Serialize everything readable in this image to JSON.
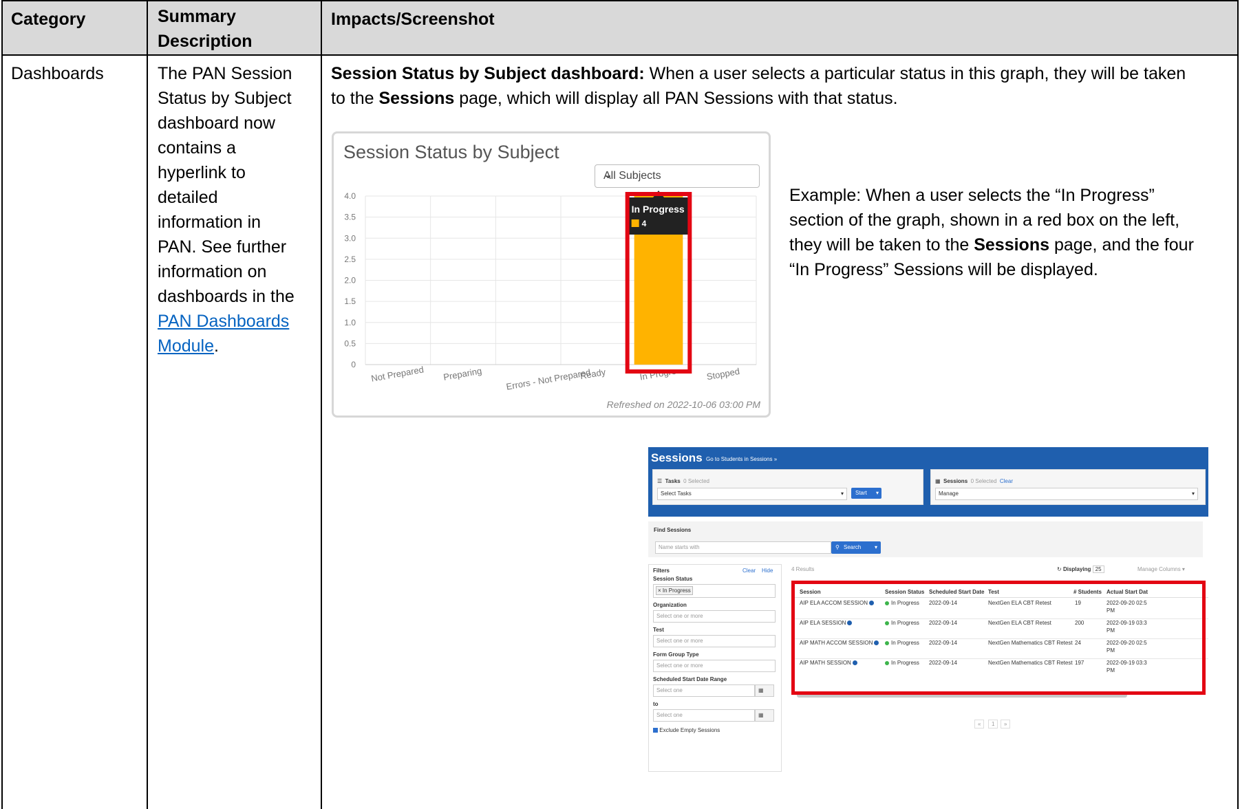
{
  "table": {
    "headers": {
      "category": "Category",
      "summary_line1": "Summary",
      "summary_line2": "Description",
      "impacts": "Impacts/Screenshot"
    },
    "row": {
      "category": "Dashboards",
      "summary_lines": [
        "The PAN Session",
        "Status by Subject",
        "dashboard now",
        "contains a",
        "hyperlink to",
        "detailed",
        "information in",
        "PAN. See further",
        "information on",
        "dashboards in the"
      ],
      "summary_link_line1": "PAN Dashboards",
      "summary_link_line2": "Module",
      "summary_period": ".",
      "impact_bold": "Session Status by Subject dashboard:",
      "impact_rest1": " When a user selects a particular status in this graph, they will be taken",
      "impact_line2_pre": "to the ",
      "impact_line2_bold": "Sessions",
      "impact_line2_post": " page, which will display all PAN Sessions with that status."
    }
  },
  "example": {
    "line1": "Example: When a user selects the “In Progress”",
    "line2": "section of the graph, shown in a red box on the left,",
    "line3_pre": "they will be taken to the ",
    "line3_bold": "Sessions",
    "line3_post": " page, and the four",
    "line4": "“In Progress” Sessions will be displayed."
  },
  "chart_data": {
    "type": "bar",
    "title": "Session Status by Subject",
    "filter_value": "All Subjects",
    "categories": [
      "Not Prepared",
      "Preparing",
      "Errors - Not Prepared",
      "Ready",
      "In Progress",
      "Stopped"
    ],
    "values": [
      0,
      0,
      0,
      0,
      4,
      0
    ],
    "ylim": [
      0,
      4.0
    ],
    "yticks": [
      "0",
      "0.5",
      "1.0",
      "1.5",
      "2.0",
      "2.5",
      "3.0",
      "3.5",
      "4.0"
    ],
    "tick_labels_visible": [
      "Not Prepared",
      "Preparing",
      "Errors - Not Prepared",
      "Ready",
      "In Progre",
      "Stopped"
    ],
    "tooltip": {
      "title": "In Progress",
      "value": "4"
    },
    "bar_color": "#ffb300",
    "highlight_color": "#e30613",
    "grid": true,
    "refreshed": "Refreshed on 2022-10-06 03:00 PM"
  },
  "sessions_screen": {
    "title": "Sessions",
    "goto_link": "Go to Students in Sessions »",
    "tasks_label": "Tasks",
    "tasks_selected": "0 Selected",
    "tasks_select": "Select Tasks",
    "start_button": "Start",
    "sessions_label": "Sessions",
    "sessions_selected": "0 Selected",
    "sessions_clear": "Clear",
    "manage_select": "Manage",
    "find_sessions": "Find Sessions",
    "search_placeholder": "Name starts with",
    "search_button": "Search",
    "filters_label": "Filters",
    "filters_clear": "Clear",
    "filters_hide": "Hide",
    "filter_session_status": "Session Status",
    "filter_status_tag": "× In Progress",
    "filter_organization": "Organization",
    "filter_organization_ph": "Select one or more",
    "filter_test": "Test",
    "filter_test_ph": "Select one or more",
    "filter_form_group": "Form Group Type",
    "filter_form_group_ph": "Select one or more",
    "filter_sched_range": "Scheduled Start Date Range",
    "filter_sched_from_ph": "Select one",
    "filter_to": "to",
    "filter_sched_to_ph": "Select one",
    "exclude_empty": "Exclude Empty Sessions",
    "results_count": "4 Results",
    "displaying_label": "Displaying",
    "displaying_value": "25",
    "manage_columns": "Manage Columns ▾",
    "columns": [
      "Session",
      "Session Status",
      "Scheduled Start Date",
      "Test",
      "# Students",
      "Actual Start Dat"
    ],
    "rows": [
      {
        "session": "AIP ELA ACCOM SESSION",
        "status": "In Progress",
        "sched": "2022-09-14",
        "test": "NextGen ELA CBT Retest",
        "students": "19",
        "actual1": "2022-09-20 02:5",
        "actual2": "PM"
      },
      {
        "session": "AIP ELA SESSION",
        "status": "In Progress",
        "sched": "2022-09-14",
        "test": "NextGen ELA CBT Retest",
        "students": "200",
        "actual1": "2022-09-19 03:3",
        "actual2": "PM"
      },
      {
        "session": "AIP MATH ACCOM SESSION",
        "status": "In Progress",
        "sched": "2022-09-14",
        "test": "NextGen Mathematics CBT Retest",
        "students": "24",
        "actual1": "2022-09-20 02:5",
        "actual2": "PM"
      },
      {
        "session": "AIP MATH SESSION",
        "status": "In Progress",
        "sched": "2022-09-14",
        "test": "NextGen Mathematics CBT Retest",
        "students": "197",
        "actual1": "2022-09-19 03:3",
        "actual2": "PM"
      }
    ],
    "pager": [
      "«",
      "1",
      "»"
    ],
    "highlight_color": "#e30613"
  }
}
